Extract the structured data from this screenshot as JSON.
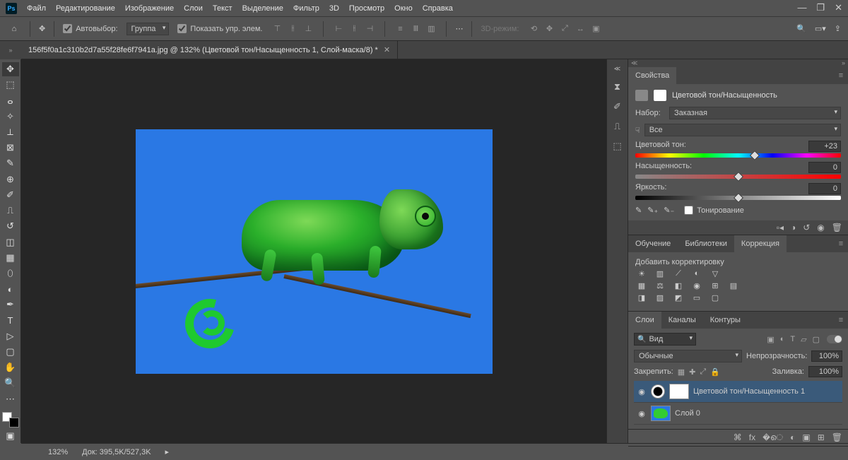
{
  "menu": {
    "items": [
      "Файл",
      "Редактирование",
      "Изображение",
      "Слои",
      "Текст",
      "Выделение",
      "Фильтр",
      "3D",
      "Просмотр",
      "Окно",
      "Справка"
    ]
  },
  "options": {
    "autoselect_label": "Автовыбор:",
    "autoselect_target": "Группа",
    "show_controls_label": "Показать упр. элем.",
    "mode3d": "3D-режим:"
  },
  "document": {
    "tab_title": "156f5f0a1c310b2d7a55f28fe6f7941a.jpg @ 132% (Цветовой тон/Насыщенность 1, Слой-маска/8) *",
    "zoom": "132%",
    "doc_size": "Док: 395,5K/527,3K"
  },
  "properties": {
    "panel_title": "Свойства",
    "adj_name": "Цветовой тон/Насыщенность",
    "preset_label": "Набор:",
    "preset_value": "Заказная",
    "range_value": "Все",
    "hue_label": "Цветовой тон:",
    "hue_value": "+23",
    "hue_pos_pct": 58,
    "sat_label": "Насыщенность:",
    "sat_value": "0",
    "sat_pos_pct": 50,
    "light_label": "Яркость:",
    "light_value": "0",
    "light_pos_pct": 50,
    "colorize_label": "Тонирование"
  },
  "adjustments": {
    "tabs": [
      "Обучение",
      "Библиотеки",
      "Коррекция"
    ],
    "active_tab": "Коррекция",
    "add_label": "Добавить корректировку"
  },
  "layers": {
    "tabs": [
      "Слои",
      "Каналы",
      "Контуры"
    ],
    "active_tab": "Слои",
    "search_placeholder": "Вид",
    "blend_label": "Обычные",
    "opacity_label": "Непрозрачность:",
    "opacity_value": "100%",
    "lock_label": "Закрепить:",
    "fill_label": "Заливка:",
    "fill_value": "100%",
    "items": [
      {
        "name": "Цветовой тон/Насыщенность 1",
        "type": "adjust",
        "selected": true
      },
      {
        "name": "Слой 0",
        "type": "image",
        "selected": false
      }
    ]
  }
}
